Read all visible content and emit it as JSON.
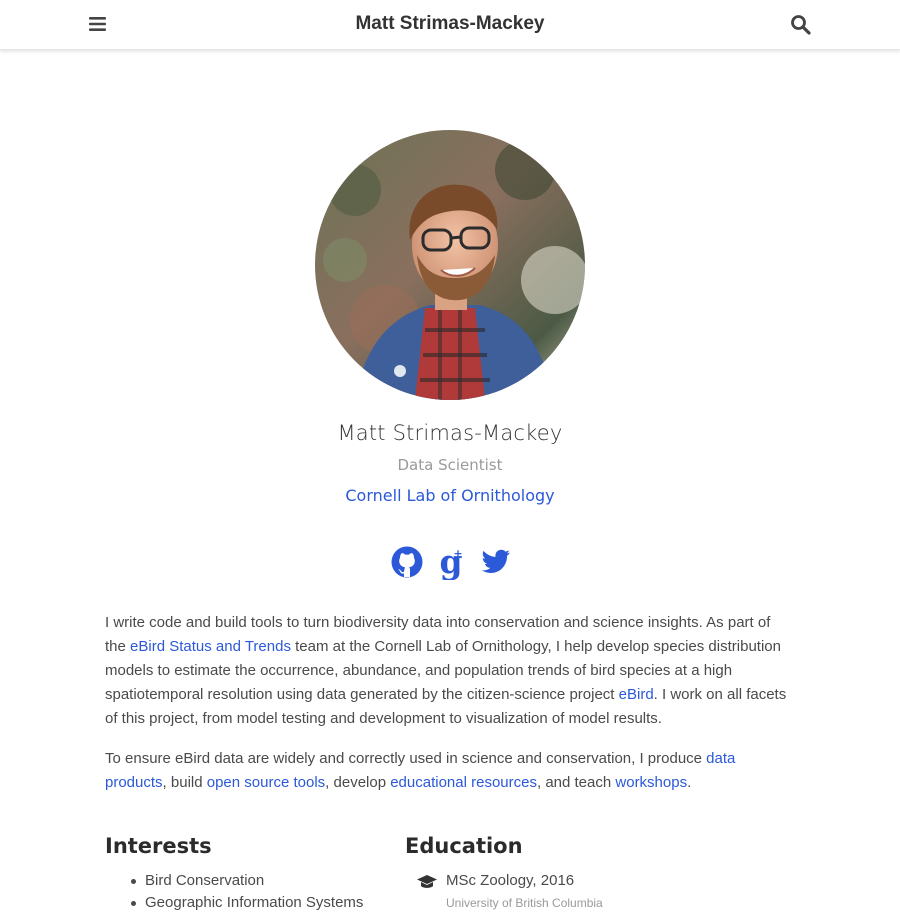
{
  "navbar": {
    "title": "Matt Strimas-Mackey",
    "menu_icon": "hamburger-menu-icon",
    "search_icon": "search-icon"
  },
  "profile": {
    "photo_alt": "avatar",
    "name": "Matt Strimas-Mackey",
    "role": "Data Scientist",
    "organization": "Cornell Lab of Ornithology",
    "social_icons": [
      "github-icon",
      "google-scholar-icon",
      "twitter-icon"
    ]
  },
  "bio": {
    "p1": {
      "t1": "I write code and build tools to turn biodiversity data into conservation and science insights. As part of the ",
      "link1": "eBird Status and Trends",
      "t2": " team at the Cornell Lab of Ornithology, I help develop species distribution models to estimate the occurrence, abundance, and population trends of bird species at a high spatiotemporal resolution using data generated by the citizen-science project ",
      "link2": "eBird",
      "t3": ". I work on all facets of this project, from model testing and development to visualization of model results."
    },
    "p2": {
      "t1": "To ensure eBird data are widely and correctly used in science and conservation, I produce ",
      "link1": "data products",
      "t2": ", build ",
      "link2": "open source tools",
      "t3": ", develop ",
      "link3": "educational resources",
      "t4": ", and teach ",
      "link4": "workshops",
      "t5": "."
    }
  },
  "interests": {
    "heading": "Interests",
    "items": [
      "Bird Conservation",
      "Geographic Information Systems"
    ]
  },
  "education": {
    "heading": "Education",
    "items": [
      {
        "degree": "MSc Zoology, 2016",
        "school": "University of British Columbia",
        "icon": "graduation-cap-icon"
      }
    ]
  },
  "colors": {
    "link": "#2b59d8",
    "text": "#4a4a4a",
    "muted": "#9a9a9a"
  }
}
